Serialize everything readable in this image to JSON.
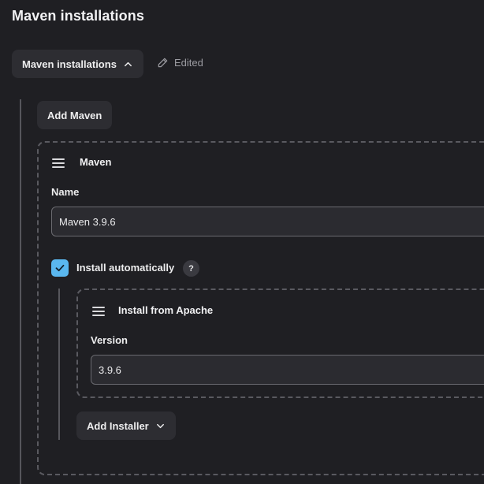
{
  "page": {
    "title": "Maven installations"
  },
  "section": {
    "toggle_label": "Maven installations",
    "toggle_icon": "chevron-up-icon",
    "edited_label": "Edited",
    "edited_icon": "pencil-icon"
  },
  "buttons": {
    "add_maven": "Add Maven",
    "add_installer": "Add Installer",
    "add_installer_icon": "chevron-down-icon"
  },
  "maven": {
    "header": "Maven",
    "name_label": "Name",
    "name_value": "Maven 3.9.6",
    "install_automatically_label": "Install automatically",
    "install_automatically_checked": true,
    "help_glyph": "?"
  },
  "installer": {
    "header": "Install from Apache",
    "version_label": "Version",
    "version_value": "3.9.6"
  },
  "colors": {
    "background": "#1f1f23",
    "button": "#2d2d32",
    "accent_checkbox": "#5ab7ef"
  }
}
